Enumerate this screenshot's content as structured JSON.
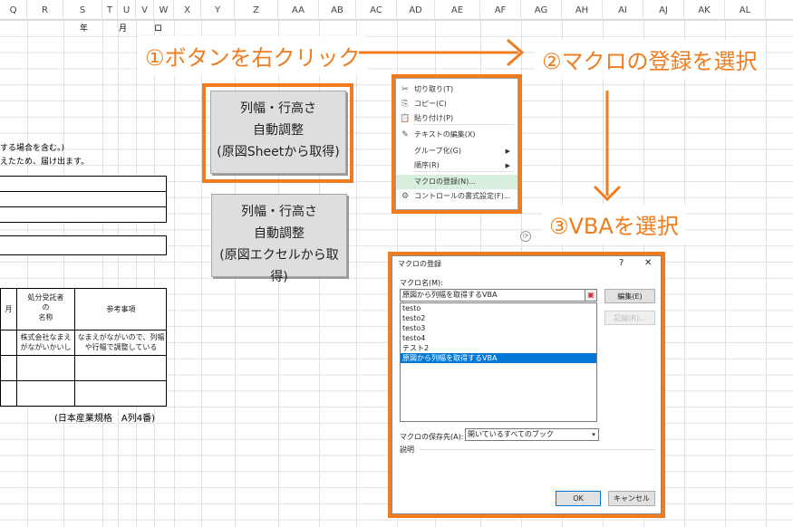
{
  "columns": [
    "Q",
    "R",
    "S",
    "T",
    "U",
    "V",
    "W",
    "X",
    "Y",
    "Z",
    "AA",
    "AB",
    "AC",
    "AD",
    "AE",
    "AF",
    "AG",
    "AH",
    "AI",
    "AJ",
    "AK",
    "AL"
  ],
  "sheet": {
    "year_label": "年",
    "month_label": "月",
    "x_mark": "ロ",
    "line1": "する場合を含む。)",
    "line2": "えたため、届け出ます。",
    "table_headers": [
      "月",
      "処分受託者\nの\n名称",
      "参考事項"
    ],
    "table_row": [
      "株式会社なまえがながいかいしゃ",
      "なまえがながいので、列幅や行幅で調整している"
    ],
    "footer_note": "(日本産業規格　A列4番)"
  },
  "buttons": {
    "btn1": [
      "列幅・行高さ",
      "自動調整",
      "(原図Sheetから取得)"
    ],
    "btn2": [
      "列幅・行高さ",
      "自動調整",
      "(原図エクセルから取得)"
    ]
  },
  "annotations": {
    "step1": "①ボタンを右クリック",
    "step2": "②マクロの登録を選択",
    "step3": "③VBAを選択"
  },
  "context_menu": {
    "items": [
      {
        "icon": "✂",
        "label": "切り取り(T)"
      },
      {
        "icon": "⎘",
        "label": "コピー(C)"
      },
      {
        "icon": "📋",
        "label": "貼り付け(P)"
      },
      {
        "icon": "✎",
        "label": "テキストの編集(X)"
      },
      {
        "icon": "",
        "label": "グループ化(G)",
        "arrow": "▶"
      },
      {
        "icon": "",
        "label": "順序(R)",
        "arrow": "▶"
      },
      {
        "icon": "",
        "label": "マクロの登録(N)..."
      },
      {
        "icon": "⚙",
        "label": "コントロールの書式設定(F)..."
      }
    ]
  },
  "macro_dialog": {
    "title": "マクロの登録",
    "help": "?",
    "close": "✕",
    "name_label": "マクロ名(M):",
    "name_value": "原図から列幅を取得するVBA",
    "macros": [
      "testo",
      "testo2",
      "testo3",
      "testo4",
      "テスト2",
      "原図から列幅を取得するVBA"
    ],
    "selected_index": 5,
    "edit_button": "編集(E)",
    "record_button": "記録(R)...",
    "location_label": "マクロの保存先(A):",
    "location_value": "開いているすべてのブック",
    "description_label": "説明",
    "ok_button": "OK",
    "cancel_button": "キャンセル"
  },
  "colors": {
    "accent": "#f07c1e",
    "selection": "#0078d7",
    "menu_highlight": "#d7efdc"
  }
}
